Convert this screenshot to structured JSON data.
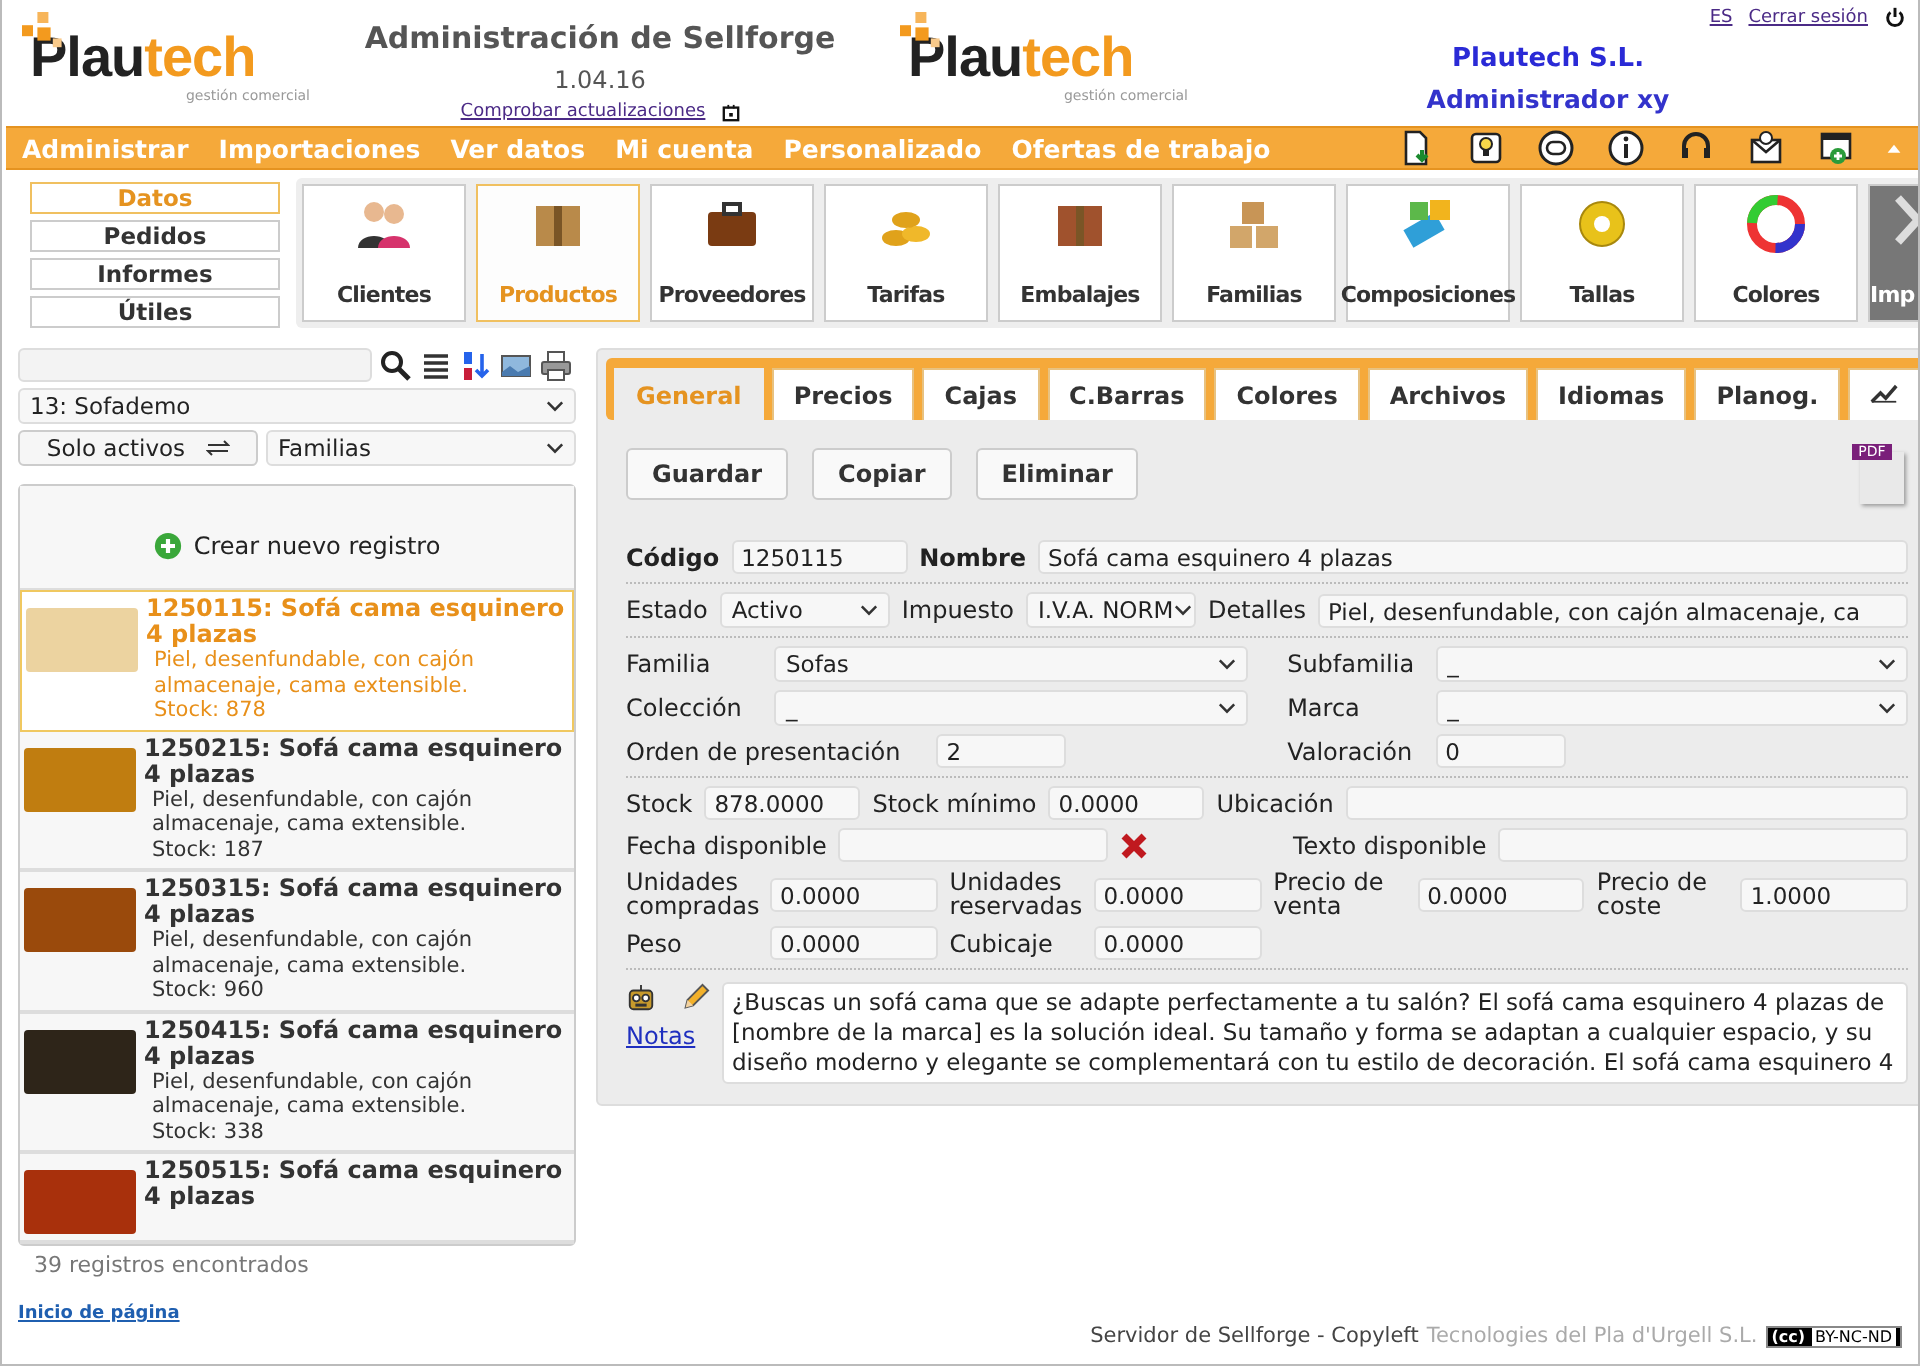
{
  "header": {
    "logo": {
      "brand": "Plau",
      "accent": "tech",
      "tagline": "gestión comercial"
    },
    "title": "Administración de Sellforge",
    "version": "1.04.16",
    "update_link": "Comprobar actualizaciones",
    "logo_center": {
      "brand": "Plau",
      "accent": "tech",
      "tagline": "gestión comercial"
    },
    "company": "Plautech S.L.",
    "user": "Administrador xy",
    "language": "ES",
    "logout": "Cerrar sesión"
  },
  "menu": {
    "items": [
      "Administrar",
      "Importaciones",
      "Ver datos",
      "Mi cuenta",
      "Personalizado",
      "Ofertas de trabajo"
    ]
  },
  "sections": [
    {
      "label": "Datos",
      "selected": true
    },
    {
      "label": "Pedidos",
      "selected": false
    },
    {
      "label": "Informes",
      "selected": false
    },
    {
      "label": "Útiles",
      "selected": false
    }
  ],
  "modules": [
    {
      "label": "Clientes",
      "selected": false
    },
    {
      "label": "Productos",
      "selected": true
    },
    {
      "label": "Proveedores",
      "selected": false
    },
    {
      "label": "Tarifas",
      "selected": false
    },
    {
      "label": "Embalajes",
      "selected": false
    },
    {
      "label": "Familias",
      "selected": false
    },
    {
      "label": "Composiciones",
      "selected": false
    },
    {
      "label": "Tallas",
      "selected": false
    },
    {
      "label": "Colores",
      "selected": false
    },
    {
      "label": "Imp",
      "selected": false
    }
  ],
  "sidebar": {
    "company_select": "13: Sofademo",
    "filter_button": "Solo activos",
    "group_select": "Familias",
    "create": "Crear nuevo registro",
    "items": [
      {
        "title": "1250115: Sofá cama esquinero 4 plazas",
        "description": "Piel, desenfundable, con cajón almacenaje, cama extensible.",
        "stock": "Stock: 878",
        "selected": true,
        "color": "#ecd3a0"
      },
      {
        "title": "1250215: Sofá cama esquinero 4 plazas",
        "description": "Piel, desenfundable, con cajón almacenaje, cama extensible.",
        "stock": "Stock: 187",
        "selected": false,
        "color": "#c07d10"
      },
      {
        "title": "1250315: Sofá cama esquinero 4 plazas",
        "description": "Piel, desenfundable, con cajón almacenaje, cama extensible.",
        "stock": "Stock: 960",
        "selected": false,
        "color": "#9a4a0c"
      },
      {
        "title": "1250415: Sofá cama esquinero 4 plazas",
        "description": "Piel, desenfundable, con cajón almacenaje, cama extensible.",
        "stock": "Stock: 338",
        "selected": false,
        "color": "#2e2519"
      },
      {
        "title": "1250515: Sofá cama esquinero 4 plazas",
        "selected": false,
        "color": "#a8300c"
      }
    ],
    "count": "39 registros encontrados",
    "top_link": "Inicio de página"
  },
  "tabs": [
    {
      "kind": "text",
      "label": "General",
      "selected": true
    },
    {
      "kind": "text",
      "label": "Precios",
      "selected": false
    },
    {
      "kind": "text",
      "label": "Cajas",
      "selected": false
    },
    {
      "kind": "text",
      "label": "C.Barras",
      "selected": false
    },
    {
      "kind": "text",
      "label": "Colores",
      "selected": false
    },
    {
      "kind": "text",
      "label": "Archivos",
      "selected": false
    },
    {
      "kind": "text",
      "label": "Idiomas",
      "selected": false
    },
    {
      "kind": "text",
      "label": "Planog.",
      "selected": false
    },
    {
      "kind": "chart",
      "selected": false
    }
  ],
  "buttons": [
    "Guardar",
    "Copiar",
    "Eliminar"
  ],
  "pdf_label": "PDF",
  "form": {
    "codigo": {
      "label": "Código",
      "value": "1250115"
    },
    "nombre": {
      "label": "Nombre",
      "value": "Sofá cama esquinero 4 plazas"
    },
    "estado": {
      "label": "Estado",
      "value": "Activo"
    },
    "impuesto": {
      "label": "Impuesto",
      "value": "I.V.A. NORM"
    },
    "detalles": {
      "label": "Detalles",
      "value": "Piel, desenfundable, con cajón almacenaje, ca"
    },
    "familia": {
      "label": "Familia",
      "value": "Sofas"
    },
    "subfamilia": {
      "label": "Subfamilia",
      "value": "_"
    },
    "coleccion": {
      "label": "Colección",
      "value": "_"
    },
    "marca": {
      "label": "Marca",
      "value": "_"
    },
    "orden": {
      "label": "Orden de presentación",
      "value": "2"
    },
    "valoracion": {
      "label": "Valoración",
      "value": "0"
    },
    "stock": {
      "label": "Stock",
      "value": "878.0000"
    },
    "stock_minimo": {
      "label": "Stock mínimo",
      "value": "0.0000"
    },
    "ubicacion": {
      "label": "Ubicación"
    },
    "fecha": {
      "label": "Fecha disponible"
    },
    "texto": {
      "label": "Texto disponible"
    },
    "compradas": {
      "label": "Unidades compradas",
      "value": "0.0000"
    },
    "reservadas": {
      "label": "Unidades reservadas",
      "value": "0.0000"
    },
    "venta": {
      "label": "Precio de venta",
      "value": "0.0000"
    },
    "coste": {
      "label": "Precio de coste",
      "value": "1.0000"
    },
    "peso": {
      "label": "Peso",
      "value": "0.0000"
    },
    "cubicaje": {
      "label": "Cubicaje",
      "value": "0.0000"
    }
  },
  "notes": {
    "label": "Notas",
    "text": "¿Buscas un sofá cama que se adapte perfectamente a tu salón? El sofá cama esquinero 4 plazas de [nombre de la marca] es la solución ideal. Su tamaño y forma se adaptan a cualquier espacio, y su diseño moderno y elegante se complementará con tu estilo de decoración. El sofá cama esquinero 4"
  },
  "footer": {
    "server": "Servidor de Sellforge - Copyleft",
    "company": "Tecnologies del Pla d'Urgell S.L.",
    "license_mark": "(cc)",
    "license": "BY-NC-ND"
  }
}
